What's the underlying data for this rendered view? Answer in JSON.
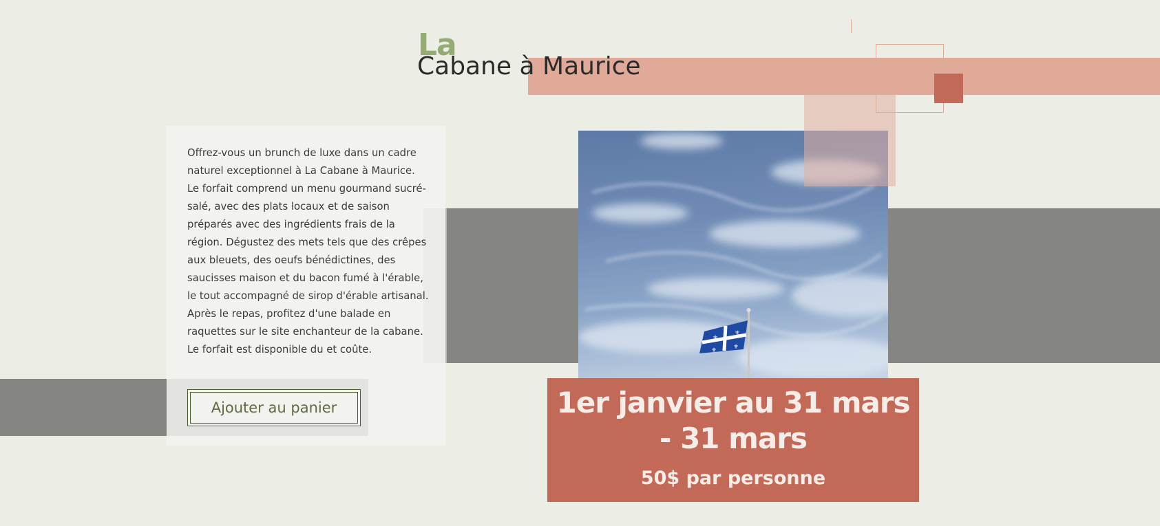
{
  "header": {
    "title_small": "La",
    "title_main": "Cabane à Maurice"
  },
  "product": {
    "description": "Offrez-vous un brunch de luxe dans un cadre naturel exceptionnel à La Cabane à Maurice. Le forfait comprend un menu gourmand sucré-salé, avec des plats locaux et de saison préparés avec des ingrédients frais de la région. Dégustez des mets tels que des crêpes aux bleuets, des oeufs bénédictines, des saucisses maison et du bacon fumé à l'érable, le tout accompagné de sirop d'érable artisanal. Après le repas, profitez d'une balade en raquettes sur le site enchanteur de la cabane. Le forfait est disponible du et coûte.",
    "add_to_cart_label": "Ajouter au panier",
    "dates": "1er janvier au 31 mars - 31 mars",
    "price": "50$ par personne"
  },
  "colors": {
    "background": "#eceee6",
    "accent_green": "#95ab74",
    "salmon": "#e0a998",
    "terracotta": "#c26a57",
    "band_gray": "#858581"
  },
  "image": {
    "subject": "sky-with-quebec-flag"
  }
}
